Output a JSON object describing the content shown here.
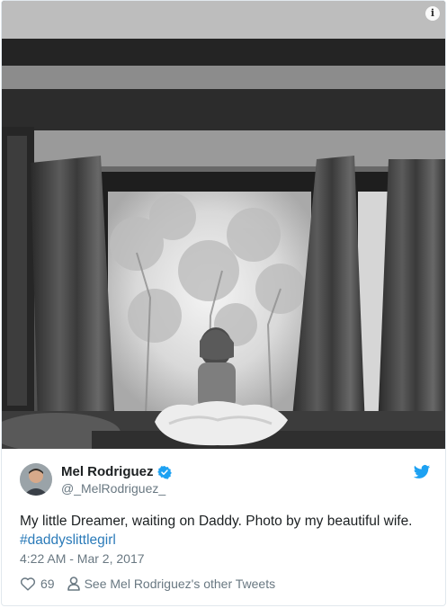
{
  "photo": {
    "info_icon_glyph": "i",
    "alt_description_icon": "info-icon"
  },
  "tweet": {
    "author_name": "Mel Rodriguez",
    "author_handle": "@_MelRodriguez_",
    "verified": true,
    "text": "My little Dreamer, waiting on Daddy. Photo by my beautiful wife.",
    "hashtag": "#daddyslittlegirl",
    "timestamp": "4:22 AM - Mar 2, 2017",
    "like_count": "69",
    "other_tweets_label": "See Mel Rodriguez's other Tweets"
  },
  "colors": {
    "link": "#2b7bb9",
    "meta_text": "#697882",
    "twitter_blue": "#1da1f2",
    "like_icon": "#697882"
  },
  "icons": {
    "verified": "verified-badge-icon",
    "bird": "twitter-bird-icon",
    "like": "heart-icon",
    "profile": "person-icon"
  }
}
